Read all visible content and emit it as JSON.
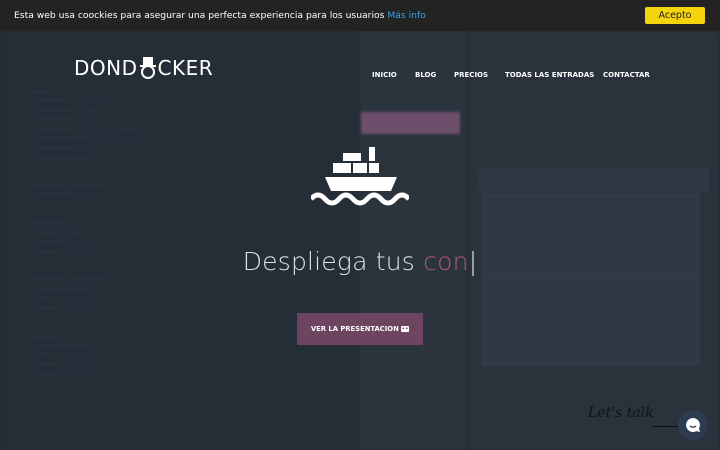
{
  "cookie_bar": {
    "message": "Esta web usa coockies para asegurar una perfecta experiencia para los usuarios",
    "more_info": "Más info",
    "accept_label": "Acepto"
  },
  "header": {
    "logo_text": "DOND●CKER",
    "nav": [
      "INICIO",
      "BLOG",
      "PRECIOS",
      "TODAS LAS ENTRADAS",
      "CONTACTAR"
    ]
  },
  "hero": {
    "headline_static": "Despliega tus ",
    "headline_typed": "con",
    "caret": "|",
    "cta_label": "VER LA PRESENTACION",
    "cta_icon": "emoji-icon"
  },
  "chat": {
    "label": "Let's talk",
    "icon": "chat-bubble-icon"
  },
  "colors": {
    "cookie_bg": "#232323",
    "accept_bg": "#f5d30f",
    "link": "#3ea0e6",
    "accent": "#b0577f",
    "cta_bg": "#6d4560",
    "chat_bg": "#2e3c52"
  }
}
